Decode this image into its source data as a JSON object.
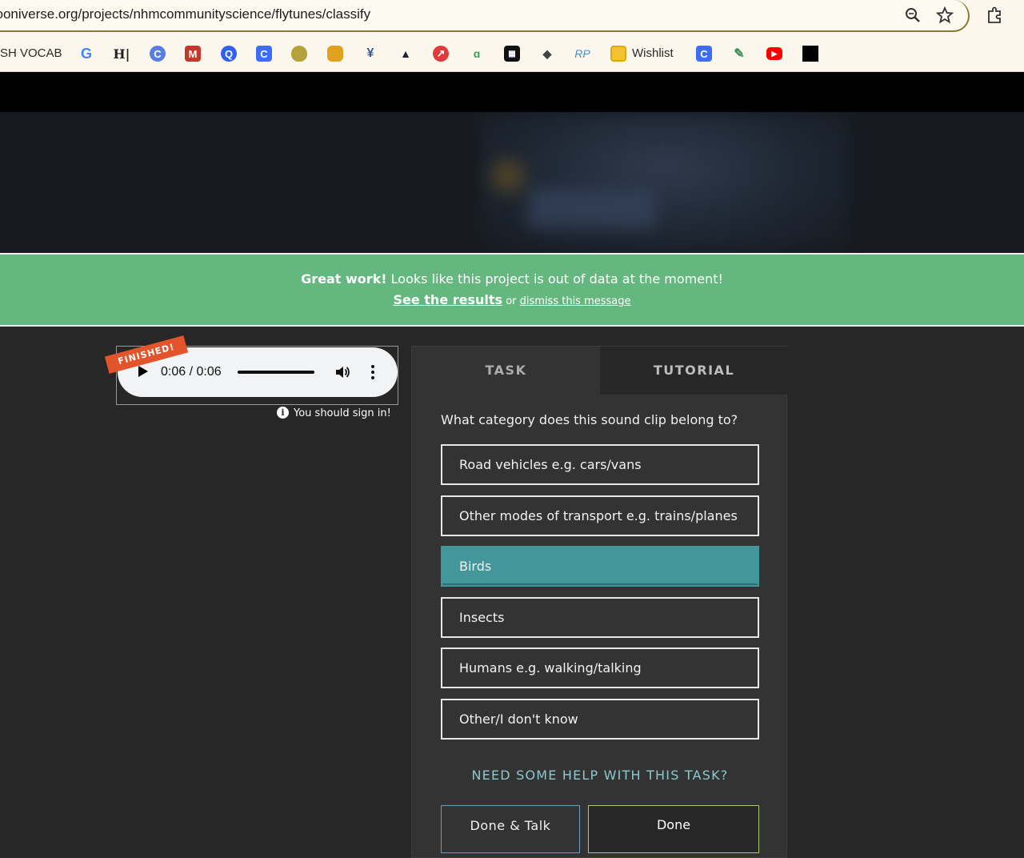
{
  "browser": {
    "url": "zooniverse.org/projects/nhmcommunityscience/flytunes/classify",
    "bookmarks": {
      "first_label": "SH VOCAB",
      "wishlist_label": "Wishlist",
      "items": [
        "G",
        "H|",
        "C",
        "M",
        "Q",
        "C",
        "pear",
        "puzzle",
        "figure",
        "cap",
        "arrow",
        "leaf",
        "qr",
        "layers",
        "RP",
        "Wishlist",
        "C",
        "feather",
        "youtube",
        "black"
      ]
    }
  },
  "banner": {
    "bold": "Great work!",
    "message": " Looks like this project is out of data at the moment!",
    "see_results": "See the results",
    "or_text": " or ",
    "dismiss": "dismiss this message"
  },
  "audio": {
    "badge": "FINISHED!",
    "time": "0:06 / 0:06",
    "progress": 1.0,
    "signin_note": "You should sign in!"
  },
  "task": {
    "tabs": [
      "TASK",
      "TUTORIAL"
    ],
    "question": "What category does this sound clip belong to?",
    "answers": [
      "Road vehicles e.g. cars/vans",
      "Other modes of transport e.g. trains/planes",
      "Birds",
      "Insects",
      "Humans e.g. walking/talking",
      "Other/I don't know"
    ],
    "selected_answer": "Birds",
    "help_link": "NEED SOME HELP WITH THIS TASK?",
    "done_talk_label": "Done & Talk",
    "done_label": "Done"
  },
  "colors": {
    "banner_green": "#64b77e",
    "selected_teal": "#43969a",
    "help_link": "#8cc8cf",
    "badge_orange": "#e4542b"
  }
}
